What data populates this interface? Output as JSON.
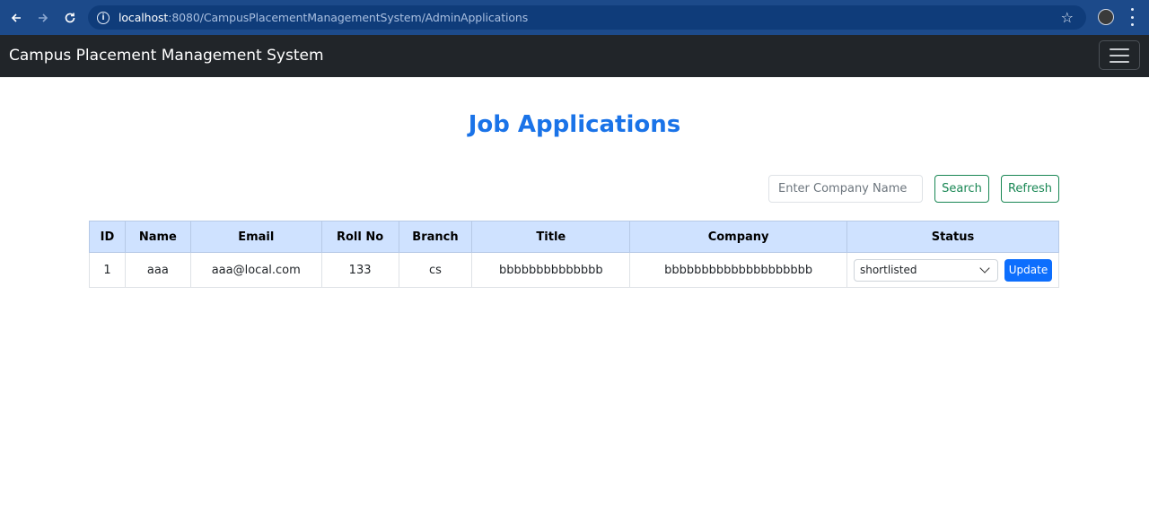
{
  "browser": {
    "url_host": "localhost",
    "url_path": ":8080/CampusPlacementManagementSystem/AdminApplications"
  },
  "navbar": {
    "brand": "Campus Placement Management System"
  },
  "main": {
    "title": "Job Applications",
    "search_placeholder": "Enter Company Name",
    "search_label": "Search",
    "refresh_label": "Refresh"
  },
  "table": {
    "headers": [
      "ID",
      "Name",
      "Email",
      "Roll No",
      "Branch",
      "Title",
      "Company",
      "Status"
    ],
    "rows": [
      {
        "id": "1",
        "name": "aaa",
        "email": "aaa@local.com",
        "roll_no": "133",
        "branch": "cs",
        "title": "bbbbbbbbbbbbbb",
        "company": "bbbbbbbbbbbbbbbbbbbb",
        "status": "shortlisted",
        "update_label": "Update"
      }
    ]
  },
  "colors": {
    "title": "#1a73e8",
    "navbar_bg": "#212529",
    "header_bg": "#cfe2ff",
    "success": "#198754",
    "primary": "#0d6efd"
  }
}
